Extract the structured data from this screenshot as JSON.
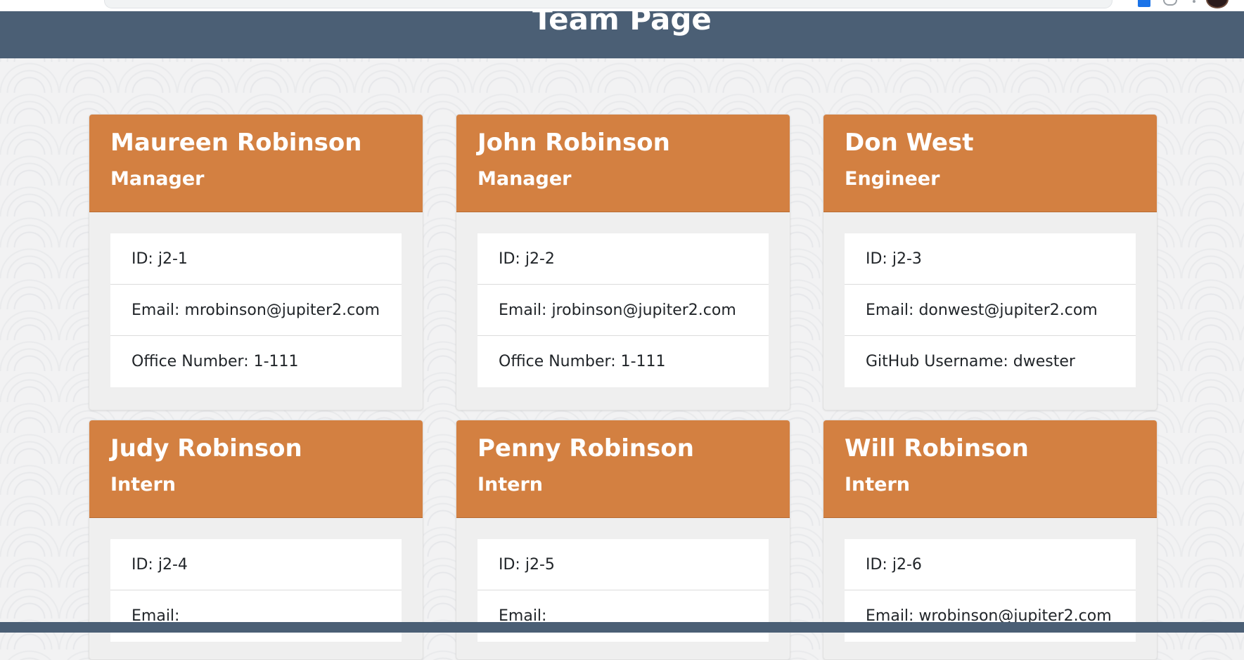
{
  "header": {
    "title": "Team Page"
  },
  "team": [
    {
      "name": "Maureen Robinson",
      "role": "Manager",
      "details": [
        "ID: j2-1",
        "Email: mrobinson@jupiter2.com",
        "Office Number: 1-111"
      ]
    },
    {
      "name": "John Robinson",
      "role": "Manager",
      "details": [
        "ID: j2-2",
        "Email: jrobinson@jupiter2.com",
        "Office Number: 1-111"
      ]
    },
    {
      "name": "Don West",
      "role": "Engineer",
      "details": [
        "ID: j2-3",
        "Email: donwest@jupiter2.com",
        "GitHub Username: dwester"
      ]
    },
    {
      "name": "Judy Robinson",
      "role": "Intern",
      "details": [
        "ID: j2-4",
        "Email:"
      ]
    },
    {
      "name": "Penny Robinson",
      "role": "Intern",
      "details": [
        "ID: j2-5",
        "Email:"
      ]
    },
    {
      "name": "Will Robinson",
      "role": "Intern",
      "details": [
        "ID: j2-6",
        "Email: wrobinson@jupiter2.com"
      ]
    }
  ],
  "colors": {
    "header_bg": "#4b5f75",
    "card_header_bg": "#d38041",
    "card_bg": "#efefef",
    "page_bg": "#f2f2f3"
  },
  "icons": {
    "browser_extension": "blue-extension-icon",
    "browser_extension_2": "gray-extension-icon",
    "profile": "avatar-icon"
  }
}
